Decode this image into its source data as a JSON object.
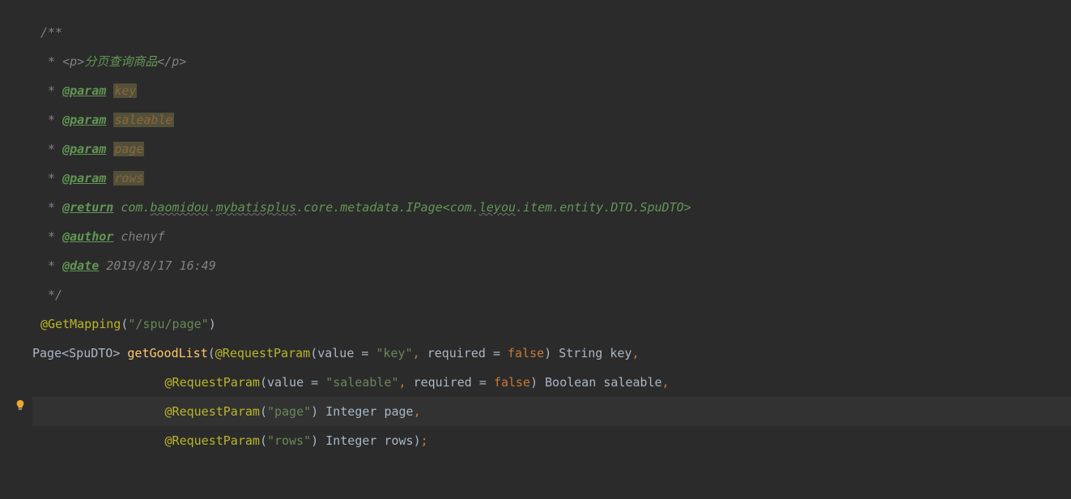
{
  "code": {
    "comment_open": "/**",
    "desc_prefix": " * ",
    "p_open": "<p>",
    "desc_text": "分页查询商品",
    "p_close": "</p>",
    "tag_param": "@param",
    "param1": "key",
    "param2": "saleable",
    "param3": "page",
    "param4": "rows",
    "tag_return": "@return",
    "return_pkg1": "com.",
    "return_wavy1": "baomidou",
    "return_dot": ".",
    "return_wavy2": "mybatisplus",
    "return_rest1": ".core.metadata.IPage<com.",
    "return_wavy3": "leyou",
    "return_rest2": ".item.entity.DTO.SpuDTO>",
    "tag_author": "@author",
    "author_val": "chenyf",
    "tag_date": "@date",
    "date_val": "2019/8/17 16:49",
    "comment_close": " */",
    "anno_getmapping": "@GetMapping",
    "mapping_path": "\"/spu/page\"",
    "type_page": "Page",
    "type_spudto": "SpuDTO",
    "fn_name": "getGoodList",
    "anno_reqparam": "@RequestParam",
    "attr_value": "value = ",
    "str_key": "\"key\"",
    "attr_required": "required = ",
    "kw_false": "false",
    "type_string": "String",
    "id_key": "key",
    "str_saleable": "\"saleable\"",
    "type_boolean": "Boolean",
    "id_saleable": "saleable",
    "str_page": "\"page\"",
    "type_integer": "Integer",
    "id_page": "page",
    "str_rows": "\"rows\"",
    "id_rows": "rows"
  }
}
